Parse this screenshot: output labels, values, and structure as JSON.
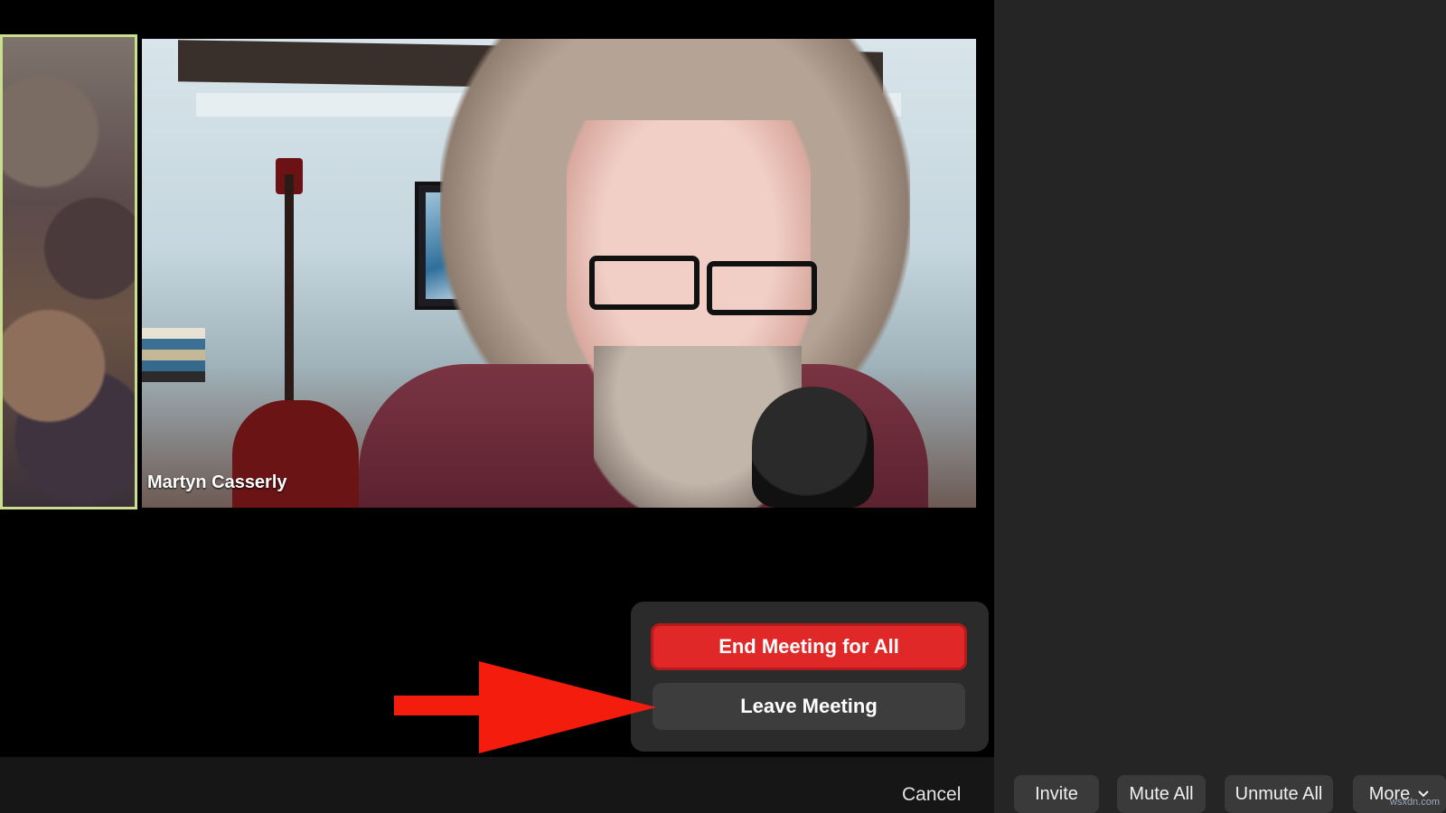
{
  "video": {
    "participant_name": "Martyn Casserly"
  },
  "leave_menu": {
    "end_label": "End Meeting for All",
    "leave_label": "Leave Meeting",
    "cancel_label": "Cancel"
  },
  "participants_panel": {
    "invite_label": "Invite",
    "mute_all_label": "Mute All",
    "unmute_all_label": "Unmute All",
    "more_label": "More"
  },
  "watermark": "wsxdn.com",
  "colors": {
    "end_button": "#e02828",
    "arrow": "#f41c0c",
    "active_speaker_border": "#c9df8e"
  }
}
